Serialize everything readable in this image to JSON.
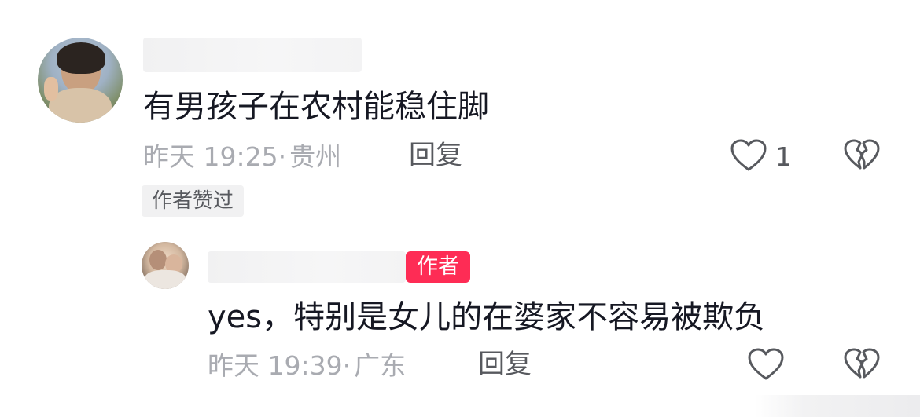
{
  "comment": {
    "text": "有男孩子在农村能稳住脚",
    "time": "昨天 19:25",
    "separator": "·",
    "location": "贵州",
    "reply_label": "回复",
    "like_count": "1",
    "author_liked_badge": "作者赞过"
  },
  "reply": {
    "author_badge": "作者",
    "text": "yes，特别是女儿的在婆家不容易被欺负",
    "time": "昨天 19:39",
    "separator": "·",
    "location": "广东",
    "reply_label": "回复"
  },
  "colors": {
    "text_primary": "#161823",
    "text_meta": "#a9abb1",
    "author_badge_bg": "#fe2c55",
    "badge_bg": "#f1f1f2"
  },
  "icons": [
    "avatar",
    "heart-icon",
    "broken-heart-icon"
  ]
}
